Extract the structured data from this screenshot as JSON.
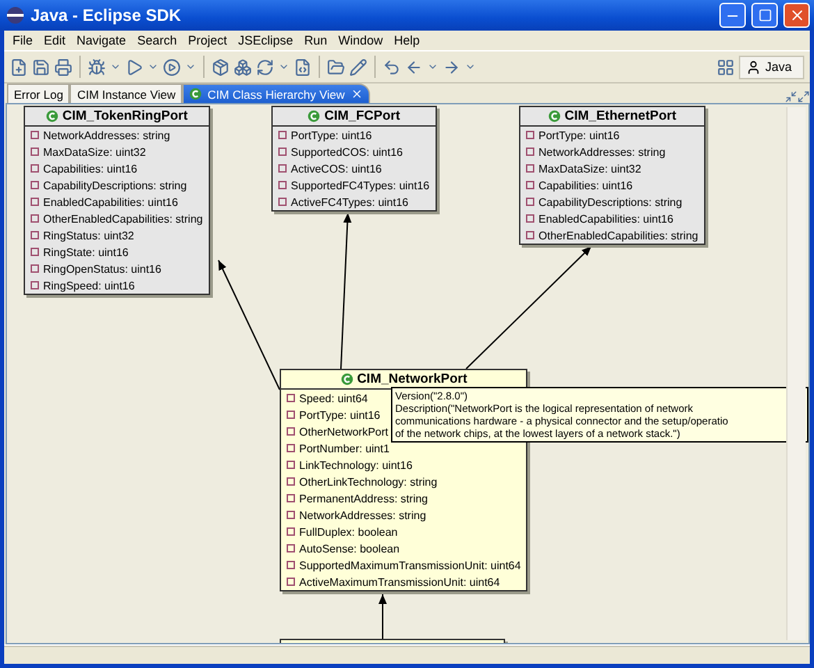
{
  "window": {
    "title": "Java - Eclipse SDK"
  },
  "menu": [
    "File",
    "Edit",
    "Navigate",
    "Search",
    "Project",
    "JSEclipse",
    "Run",
    "Window",
    "Help"
  ],
  "perspective": {
    "label": "Java"
  },
  "tabs": [
    {
      "label": "Error Log",
      "selected": false
    },
    {
      "label": "CIM Instance View",
      "selected": false
    },
    {
      "label": "CIM Class Hierarchy View",
      "selected": true
    }
  ],
  "classes": [
    {
      "name": "CIM_TokenRingPort",
      "attributes": [
        "NetworkAddresses: string",
        "MaxDataSize: uint32",
        "Capabilities: uint16",
        "CapabilityDescriptions: string",
        "EnabledCapabilities: uint16",
        "OtherEnabledCapabilities: string",
        "RingStatus: uint32",
        "RingState: uint16",
        "RingOpenStatus: uint16",
        "RingSpeed: uint16"
      ],
      "selected": false
    },
    {
      "name": "CIM_FCPort",
      "attributes": [
        "PortType: uint16",
        "SupportedCOS: uint16",
        "ActiveCOS: uint16",
        "SupportedFC4Types: uint16",
        "ActiveFC4Types: uint16"
      ],
      "selected": false
    },
    {
      "name": "CIM_EthernetPort",
      "attributes": [
        "PortType: uint16",
        "NetworkAddresses: string",
        "MaxDataSize: uint32",
        "Capabilities: uint16",
        "CapabilityDescriptions: string",
        "EnabledCapabilities: uint16",
        "OtherEnabledCapabilities: string"
      ],
      "selected": false
    },
    {
      "name": "CIM_NetworkPort",
      "attributes": [
        "Speed: uint64",
        "PortType: uint16",
        "OtherNetworkPort",
        "PortNumber: uint1",
        "LinkTechnology: uint16",
        "OtherLinkTechnology: string",
        "PermanentAddress: string",
        "NetworkAddresses: string",
        "FullDuplex: boolean",
        "AutoSense: boolean",
        "SupportedMaximumTransmissionUnit: uint64",
        "ActiveMaximumTransmissionUnit: uint64"
      ],
      "selected": true
    }
  ],
  "tooltip": {
    "lines": [
      "Version(\"2.8.0\")",
      "Description(\"NetworkPort is the logical representation of network",
      "communications hardware - a physical connector and the setup/operatio",
      "of the network chips, at the lowest layers of a network stack.\")"
    ]
  }
}
